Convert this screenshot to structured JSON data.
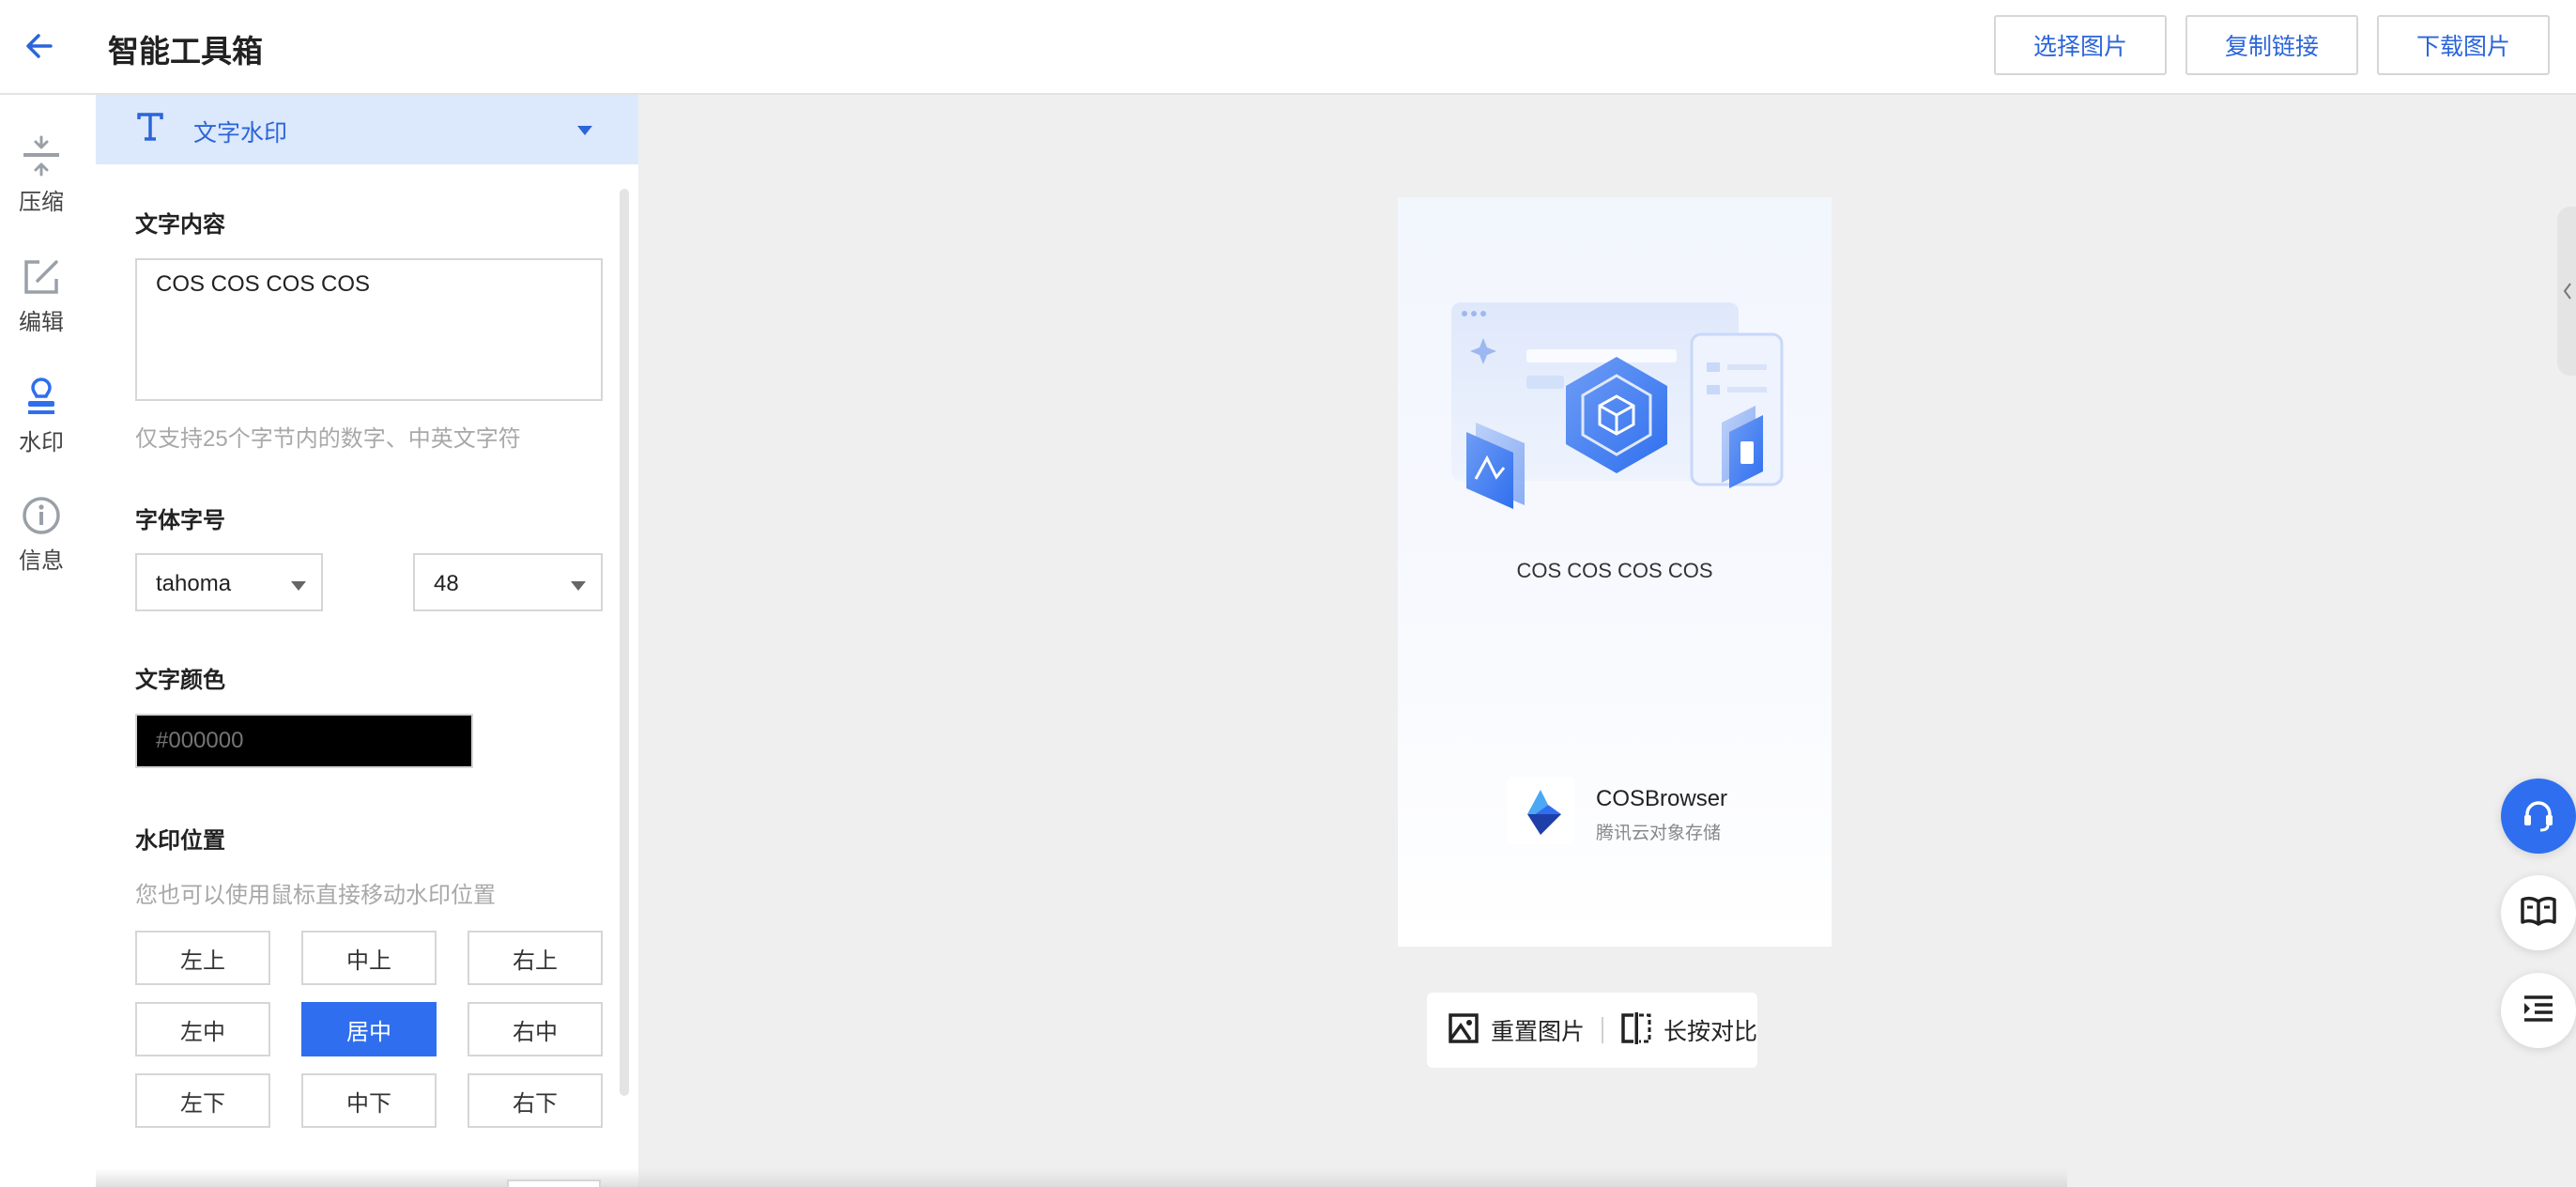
{
  "header": {
    "title": "智能工具箱",
    "buttons": {
      "select_image": "选择图片",
      "copy_link": "复制链接",
      "download_image": "下载图片"
    }
  },
  "rail": {
    "compress": "压缩",
    "edit": "编辑",
    "watermark": "水印",
    "info": "信息"
  },
  "panel": {
    "header_label": "文字水印",
    "text_content": {
      "title": "文字内容",
      "value": "COS COS COS COS",
      "hint": "仅支持25个字节内的数字、中英文字符"
    },
    "font": {
      "title": "字体字号",
      "family": "tahoma",
      "size": "48"
    },
    "color": {
      "title": "文字颜色",
      "placeholder": "#000000",
      "value_hex": "#000000"
    },
    "position": {
      "title": "水印位置",
      "hint": "您也可以使用鼠标直接移动水印位置",
      "top_left": "左上",
      "top_center": "中上",
      "top_right": "右上",
      "middle_left": "左中",
      "center": "居中",
      "middle_right": "右中",
      "bottom_left": "左下",
      "bottom_center": "中下",
      "bottom_right": "右下",
      "selected": "居中"
    }
  },
  "preview": {
    "watermark_text": "COS COS COS COS",
    "brand_name": "COSBrowser",
    "brand_sub": "腾讯云对象存储"
  },
  "toolbar": {
    "reset": "重置图片",
    "compare": "长按对比"
  },
  "colors": {
    "accent": "#2f6fef",
    "accent_text": "#2b65d9",
    "panel_header_bg": "#dce8fc"
  },
  "icons": {
    "back": "arrow-left-icon",
    "compress": "compress-icon",
    "edit": "edit-icon",
    "watermark": "stamp-icon",
    "info": "info-icon",
    "text": "text-t-icon",
    "support": "headset-icon",
    "docs": "open-book-icon",
    "menu": "list-menu-icon",
    "reset": "image-icon",
    "compare": "compare-icon"
  }
}
